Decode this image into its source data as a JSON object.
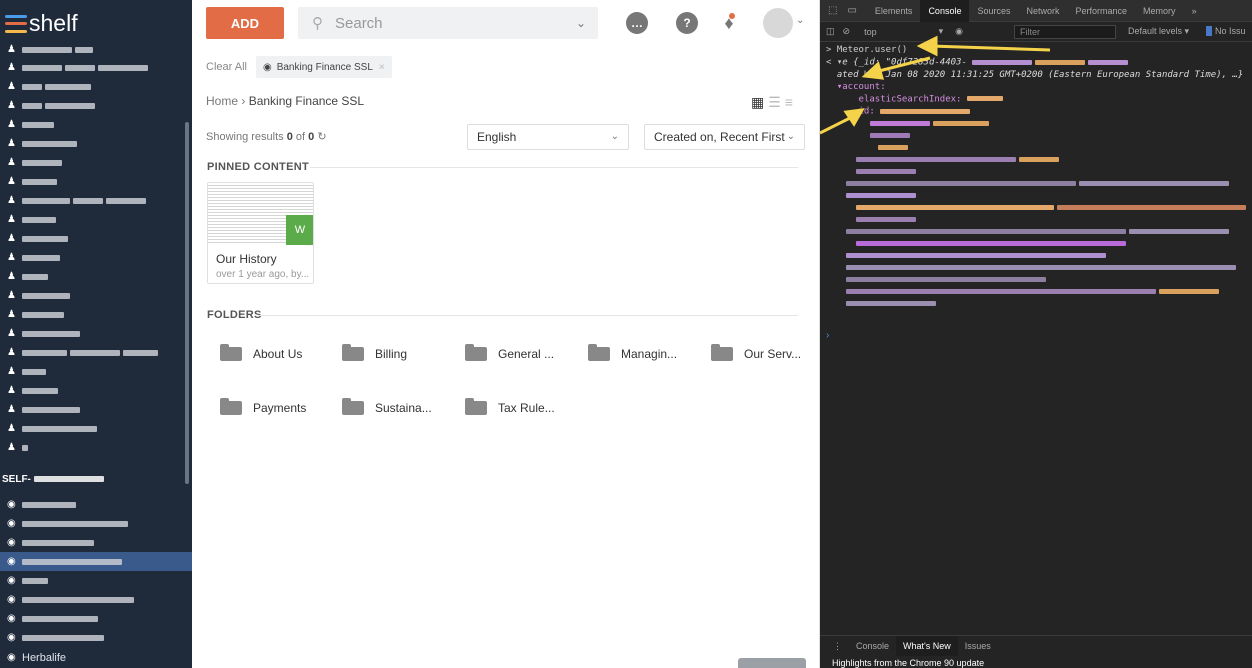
{
  "sidebar": {
    "logo_text": "shelf",
    "logo_colors": [
      "#4a9be8",
      "#e16c45",
      "#f2b84b"
    ],
    "section_heading": "SELF-",
    "last_item": "Herbalife"
  },
  "header": {
    "add_label": "ADD",
    "search_placeholder": "Search",
    "colors": {
      "accent": "#e16c45",
      "success": "#5cab4b"
    }
  },
  "filters": {
    "clear_all": "Clear All",
    "chip_label": "Banking Finance SSL"
  },
  "breadcrumb": {
    "home": "Home",
    "current": "Banking Finance SSL"
  },
  "results": {
    "prefix": "Showing results",
    "shown": "0",
    "of": "of",
    "total": "0",
    "language": "English",
    "sort": "Created on, Recent First"
  },
  "pinned": {
    "title": "PINNED CONTENT",
    "card_title": "Our History",
    "card_meta": "over 1 year ago, by..."
  },
  "folders": {
    "title": "FOLDERS",
    "items": [
      "About Us",
      "Billing",
      "General ...",
      "Managin...",
      "Our Serv...",
      "Payments",
      "Sustaina...",
      "Tax Rule..."
    ]
  },
  "devtools": {
    "tabs": [
      "Elements",
      "Console",
      "Sources",
      "Network",
      "Performance",
      "Memory"
    ],
    "more": "»",
    "context": "top",
    "filter_placeholder": "Filter",
    "levels": "Default levels ▾",
    "issues": "No Issu",
    "console": {
      "command": "Meteor.user()",
      "obj_start": "e {_id: \"0df7283d-4403-",
      "created_prefix": "ated",
      "created": "Wed Jan 08 2020 11:31:25 GMT+0200 (Eastern European Standard Time), …}",
      "account_key": "▾account:",
      "elastic_key": "elasticSearchIndex:",
      "id_key": "id:"
    },
    "drawer_tabs": [
      "Console",
      "What's New",
      "Issues"
    ],
    "drawer_text": "Highlights from the Chrome 90 update"
  }
}
